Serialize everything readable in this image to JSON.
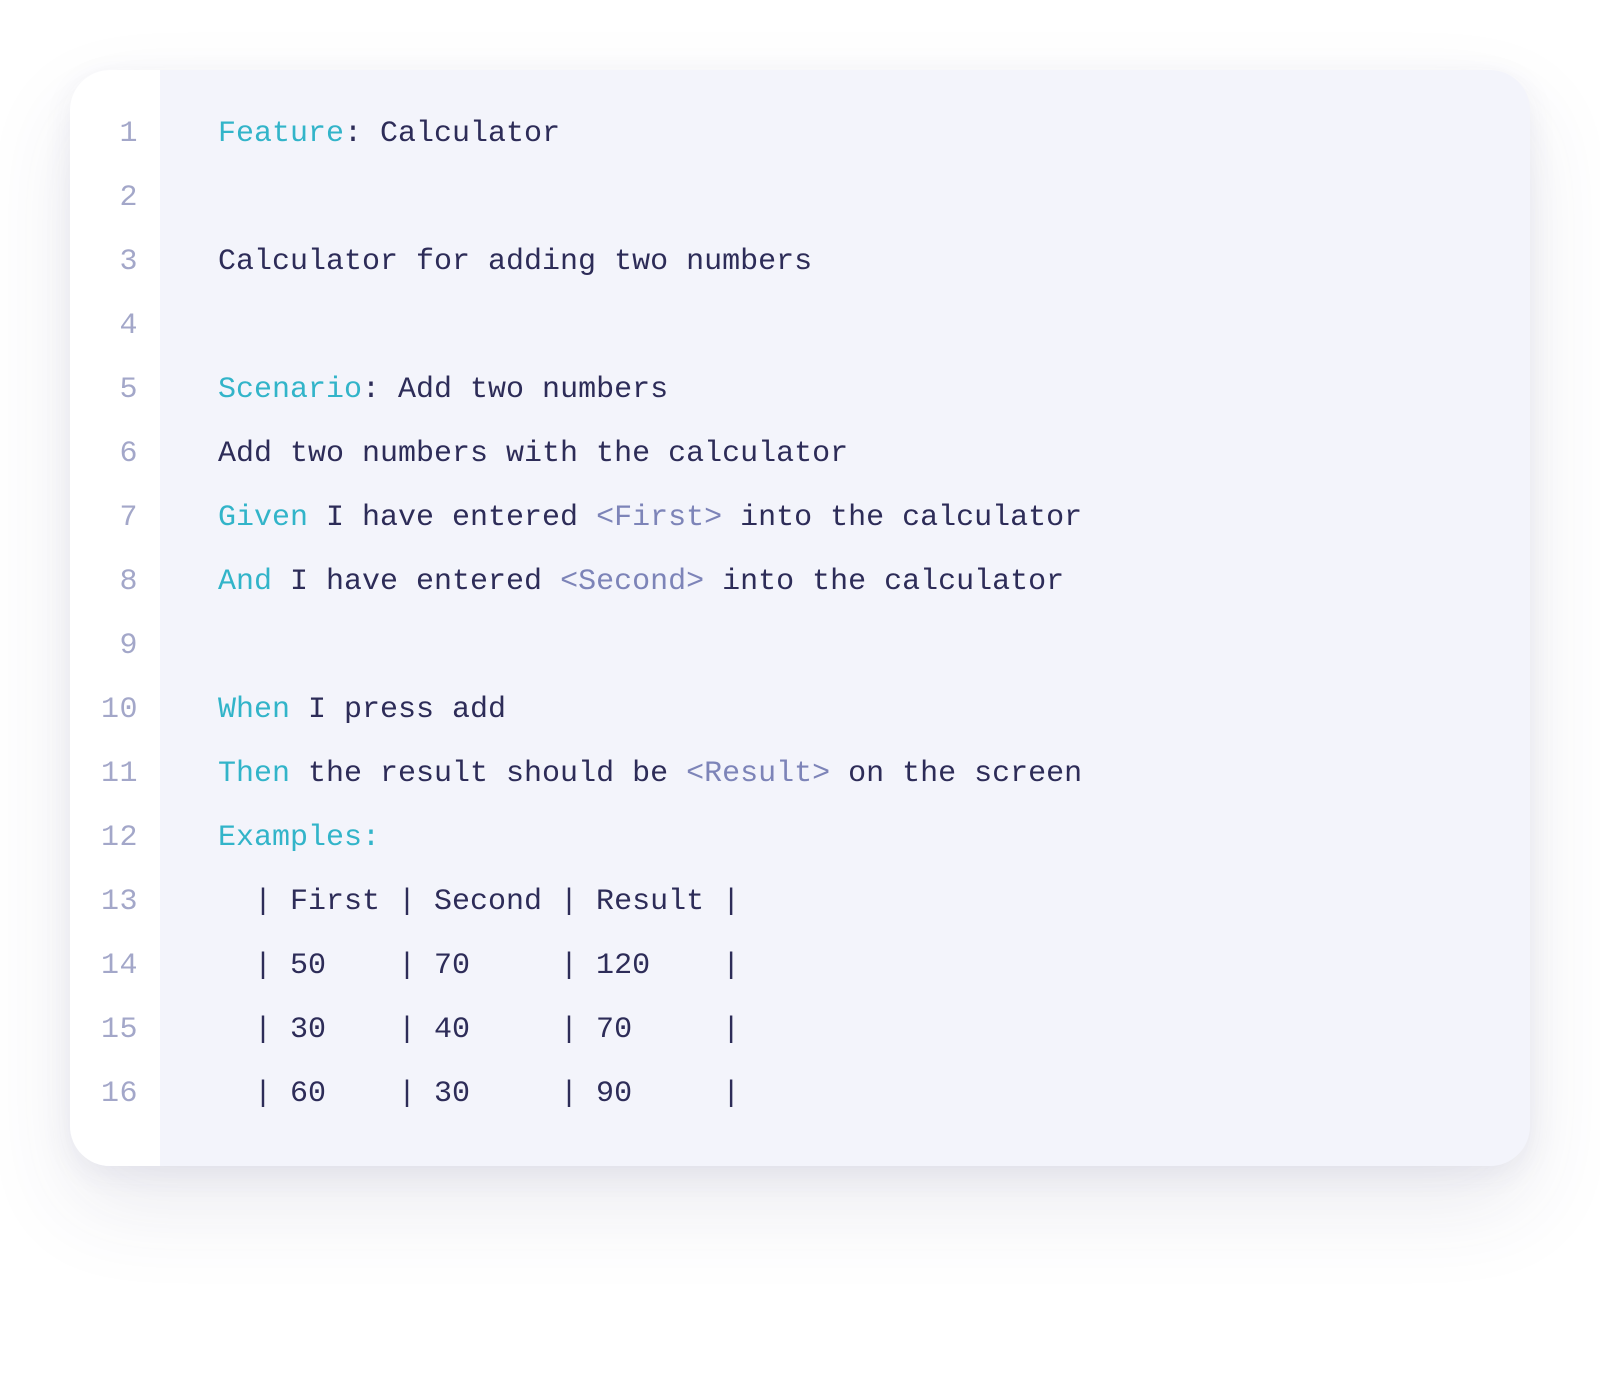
{
  "lineTotal": 16,
  "lines": {
    "1": [
      {
        "cls": "kw",
        "t": "Feature"
      },
      {
        "cls": "txt",
        "t": ": Calculator"
      }
    ],
    "2": [],
    "3": [
      {
        "cls": "txt",
        "t": "Calculator for adding two numbers"
      }
    ],
    "4": [],
    "5": [
      {
        "cls": "kw",
        "t": "Scenario"
      },
      {
        "cls": "txt",
        "t": ": Add two numbers"
      }
    ],
    "6": [
      {
        "cls": "txt",
        "t": "Add two numbers with the calculator"
      }
    ],
    "7": [
      {
        "cls": "kw",
        "t": "Given"
      },
      {
        "cls": "txt",
        "t": " I have entered "
      },
      {
        "cls": "param",
        "t": "<First>"
      },
      {
        "cls": "txt",
        "t": " into the calculator"
      }
    ],
    "8": [
      {
        "cls": "kw",
        "t": "And"
      },
      {
        "cls": "txt",
        "t": " I have entered "
      },
      {
        "cls": "param",
        "t": "<Second>"
      },
      {
        "cls": "txt",
        "t": " into the calculator"
      }
    ],
    "9": [],
    "10": [
      {
        "cls": "kw",
        "t": "When"
      },
      {
        "cls": "txt",
        "t": " I press add"
      }
    ],
    "11": [
      {
        "cls": "kw",
        "t": "Then"
      },
      {
        "cls": "txt",
        "t": " the result should be "
      },
      {
        "cls": "param",
        "t": "<Result>"
      },
      {
        "cls": "txt",
        "t": " on the screen"
      }
    ],
    "12": [
      {
        "cls": "kw",
        "t": "Examples:"
      }
    ],
    "13": [
      {
        "cls": "txt",
        "t": "  | First | Second | Result |"
      }
    ],
    "14": [
      {
        "cls": "txt",
        "t": "  | 50    | 70     | 120    |"
      }
    ],
    "15": [
      {
        "cls": "txt",
        "t": "  | 30    | 40     | 70     |"
      }
    ],
    "16": [
      {
        "cls": "txt",
        "t": "  | 60    | 30     | 90     |"
      }
    ]
  }
}
